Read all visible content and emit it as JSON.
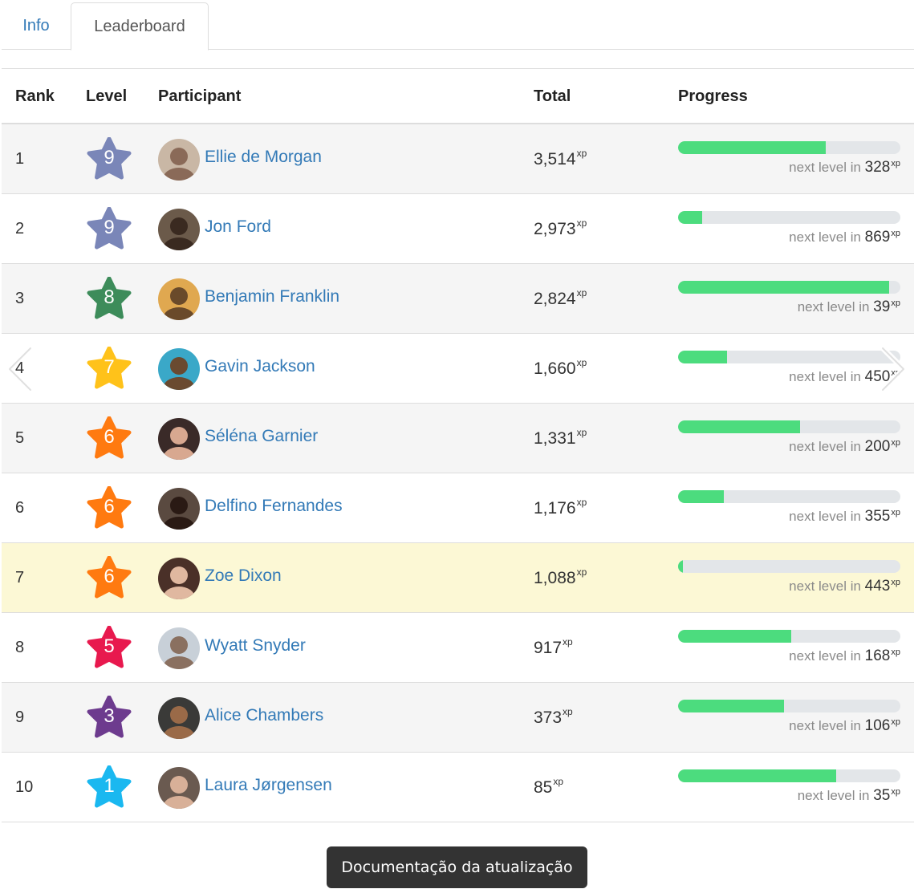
{
  "tabs": [
    {
      "label": "Info"
    },
    {
      "label": "Leaderboard"
    }
  ],
  "columns": {
    "rank": "Rank",
    "level": "Level",
    "participant": "Participant",
    "total": "Total",
    "progress": "Progress"
  },
  "xp_suffix": "xp",
  "next_level_label": "next level in",
  "level_colors": {
    "9": "#7a86b8",
    "8": "#3d8c5a",
    "7": "#ffc21a",
    "6": "#ff7a10",
    "5": "#e8194e",
    "3": "#6d3b8e",
    "1": "#1ab8f0"
  },
  "rows": [
    {
      "rank": "1",
      "level": "9",
      "name": "Ellie de Morgan",
      "total": "3,514",
      "progress": 0.665,
      "next": "328",
      "avatar_bg": "#c9b7a5",
      "avatar_fg": "#8a6a58"
    },
    {
      "rank": "2",
      "level": "9",
      "name": "Jon Ford",
      "total": "2,973",
      "progress": 0.11,
      "next": "869",
      "avatar_bg": "#6b5a4a",
      "avatar_fg": "#3a2a20"
    },
    {
      "rank": "3",
      "level": "8",
      "name": "Benjamin Franklin",
      "total": "2,824",
      "progress": 0.95,
      "next": "39",
      "avatar_bg": "#e0a850",
      "avatar_fg": "#6a4a2a"
    },
    {
      "rank": "4",
      "level": "7",
      "name": "Gavin Jackson",
      "total": "1,660",
      "progress": 0.22,
      "next": "450",
      "avatar_bg": "#3aa8c8",
      "avatar_fg": "#6a4a30"
    },
    {
      "rank": "5",
      "level": "6",
      "name": "Séléna Garnier",
      "total": "1,331",
      "progress": 0.55,
      "next": "200",
      "avatar_bg": "#3a2a28",
      "avatar_fg": "#d8a890"
    },
    {
      "rank": "6",
      "level": "6",
      "name": "Delfino Fernandes",
      "total": "1,176",
      "progress": 0.205,
      "next": "355",
      "avatar_bg": "#5a4a40",
      "avatar_fg": "#2a1a14"
    },
    {
      "rank": "7",
      "level": "6",
      "name": "Zoe Dixon",
      "total": "1,088",
      "progress": 0.02,
      "next": "443",
      "avatar_bg": "#4a3028",
      "avatar_fg": "#e0b8a0"
    },
    {
      "rank": "8",
      "level": "5",
      "name": "Wyatt Snyder",
      "total": "917",
      "progress": 0.51,
      "next": "168",
      "avatar_bg": "#c8d0d8",
      "avatar_fg": "#8a7060"
    },
    {
      "rank": "9",
      "level": "3",
      "name": "Alice Chambers",
      "total": "373",
      "progress": 0.475,
      "next": "106",
      "avatar_bg": "#3a3a38",
      "avatar_fg": "#9a6a48"
    },
    {
      "rank": "10",
      "level": "1",
      "name": "Laura Jørgensen",
      "total": "85",
      "progress": 0.71,
      "next": "35",
      "avatar_bg": "#6a5a50",
      "avatar_fg": "#d8b098"
    }
  ],
  "highlight_rank": "7",
  "tooltip": "Documentação da atualização"
}
